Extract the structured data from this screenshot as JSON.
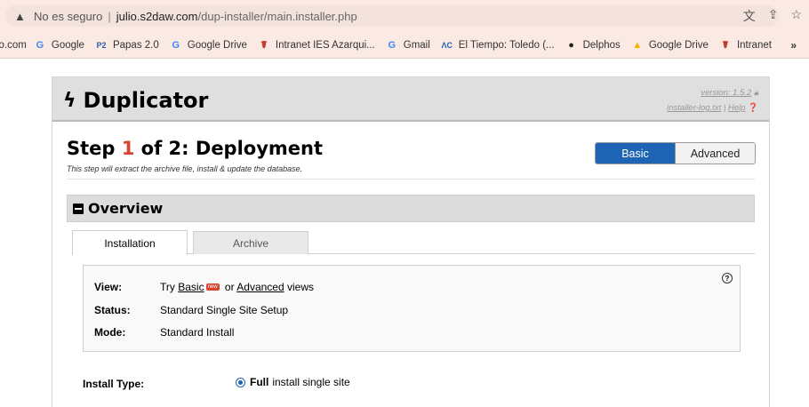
{
  "browser": {
    "insecure_label": "No es seguro",
    "separator": "|",
    "url_host": "julio.s2daw.com",
    "url_path": "/dup-installer/main.installer.php"
  },
  "bookmarks": [
    {
      "label": "io.com",
      "icon": "globe-icon"
    },
    {
      "label": "Google",
      "icon": "google-icon"
    },
    {
      "label": "Papas 2.0",
      "icon": "p2-icon"
    },
    {
      "label": "Google Drive",
      "icon": "google-icon"
    },
    {
      "label": "Intranet IES Azarqui...",
      "icon": "intranet-icon"
    },
    {
      "label": "Gmail",
      "icon": "google-icon"
    },
    {
      "label": "El Tiempo: Toledo (...",
      "icon": "eltiempo-icon"
    },
    {
      "label": "Delphos",
      "icon": "delphos-icon"
    },
    {
      "label": "Google Drive",
      "icon": "drive-icon"
    },
    {
      "label": "Intranet",
      "icon": "intranet-icon"
    }
  ],
  "bookmarks_more": "»",
  "header": {
    "brand": "Duplicator",
    "version_link": "version: 1.5.2",
    "log_link": "installer-log.txt",
    "link_sep": "|",
    "help_link": "Help"
  },
  "step": {
    "prefix": "Step ",
    "number": "1",
    "suffix": " of 2: Deployment",
    "subtitle": "This step will extract the archive file, install & update the database."
  },
  "mode_toggle": {
    "basic_label": "Basic",
    "advanced_label": "Advanced",
    "selected": "Basic"
  },
  "overview": {
    "title": "Overview",
    "tabs": [
      {
        "label": "Installation",
        "active": true
      },
      {
        "label": "Archive",
        "active": false
      }
    ],
    "view_label": "View:",
    "view_try": "Try ",
    "view_basic": "Basic",
    "view_new": "new",
    "view_or": " or ",
    "view_advanced": "Advanced",
    "view_views": " views",
    "status_label": "Status:",
    "status_value": "Standard Single Site Setup",
    "mode_label": "Mode:",
    "mode_value": "Standard Install",
    "help_icon": "?"
  },
  "install_type": {
    "label": "Install Type:",
    "option_bold": "Full",
    "option_rest": "install single site",
    "checked": true
  },
  "colors": {
    "accent_blue": "#1e64b4",
    "step_red": "#d9442f"
  }
}
